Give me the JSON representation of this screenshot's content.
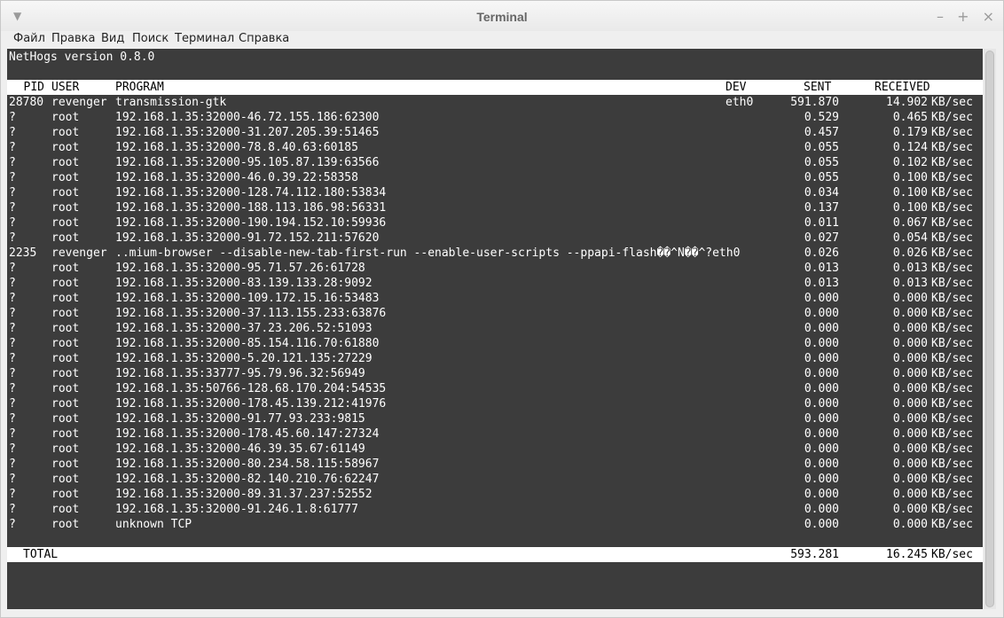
{
  "window": {
    "title": "Terminal",
    "menu_icon": "chevron-down-icon",
    "buttons": {
      "minimize": "–",
      "maximize": "+",
      "close": "×"
    }
  },
  "menu": [
    "Файл",
    "Правка",
    "Вид",
    "Поиск",
    "Терминал",
    "Справка"
  ],
  "terminal": {
    "version_line": "NetHogs version 0.8.0",
    "headers": {
      "pid": "PID",
      "user": "USER",
      "program": "PROGRAM",
      "dev": "DEV",
      "sent": "SENT",
      "received": "RECEIVED"
    },
    "rows": [
      {
        "pid": "28780",
        "user": "revenger",
        "program": "transmission-gtk",
        "dev": "eth0",
        "sent": "591.870",
        "received": "14.902",
        "unit": "KB/sec"
      },
      {
        "pid": "?",
        "user": "root",
        "program": "192.168.1.35:32000-46.72.155.186:62300",
        "dev": "",
        "sent": "0.529",
        "received": "0.465",
        "unit": "KB/sec"
      },
      {
        "pid": "?",
        "user": "root",
        "program": "192.168.1.35:32000-31.207.205.39:51465",
        "dev": "",
        "sent": "0.457",
        "received": "0.179",
        "unit": "KB/sec"
      },
      {
        "pid": "?",
        "user": "root",
        "program": "192.168.1.35:32000-78.8.40.63:60185",
        "dev": "",
        "sent": "0.055",
        "received": "0.124",
        "unit": "KB/sec"
      },
      {
        "pid": "?",
        "user": "root",
        "program": "192.168.1.35:32000-95.105.87.139:63566",
        "dev": "",
        "sent": "0.055",
        "received": "0.102",
        "unit": "KB/sec"
      },
      {
        "pid": "?",
        "user": "root",
        "program": "192.168.1.35:32000-46.0.39.22:58358",
        "dev": "",
        "sent": "0.055",
        "received": "0.100",
        "unit": "KB/sec"
      },
      {
        "pid": "?",
        "user": "root",
        "program": "192.168.1.35:32000-128.74.112.180:53834",
        "dev": "",
        "sent": "0.034",
        "received": "0.100",
        "unit": "KB/sec"
      },
      {
        "pid": "?",
        "user": "root",
        "program": "192.168.1.35:32000-188.113.186.98:56331",
        "dev": "",
        "sent": "0.137",
        "received": "0.100",
        "unit": "KB/sec"
      },
      {
        "pid": "?",
        "user": "root",
        "program": "192.168.1.35:32000-190.194.152.10:59936",
        "dev": "",
        "sent": "0.011",
        "received": "0.067",
        "unit": "KB/sec"
      },
      {
        "pid": "?",
        "user": "root",
        "program": "192.168.1.35:32000-91.72.152.211:57620",
        "dev": "",
        "sent": "0.027",
        "received": "0.054",
        "unit": "KB/sec"
      },
      {
        "pid": "2235",
        "user": "revenger",
        "program": "..mium-browser --disable-new-tab-first-run --enable-user-scripts --ppapi-flash��^N��^?eth0",
        "dev": "",
        "sent": "0.026",
        "received": "0.026",
        "unit": "KB/sec"
      },
      {
        "pid": "?",
        "user": "root",
        "program": "192.168.1.35:32000-95.71.57.26:61728",
        "dev": "",
        "sent": "0.013",
        "received": "0.013",
        "unit": "KB/sec"
      },
      {
        "pid": "?",
        "user": "root",
        "program": "192.168.1.35:32000-83.139.133.28:9092",
        "dev": "",
        "sent": "0.013",
        "received": "0.013",
        "unit": "KB/sec"
      },
      {
        "pid": "?",
        "user": "root",
        "program": "192.168.1.35:32000-109.172.15.16:53483",
        "dev": "",
        "sent": "0.000",
        "received": "0.000",
        "unit": "KB/sec"
      },
      {
        "pid": "?",
        "user": "root",
        "program": "192.168.1.35:32000-37.113.155.233:63876",
        "dev": "",
        "sent": "0.000",
        "received": "0.000",
        "unit": "KB/sec"
      },
      {
        "pid": "?",
        "user": "root",
        "program": "192.168.1.35:32000-37.23.206.52:51093",
        "dev": "",
        "sent": "0.000",
        "received": "0.000",
        "unit": "KB/sec"
      },
      {
        "pid": "?",
        "user": "root",
        "program": "192.168.1.35:32000-85.154.116.70:61880",
        "dev": "",
        "sent": "0.000",
        "received": "0.000",
        "unit": "KB/sec"
      },
      {
        "pid": "?",
        "user": "root",
        "program": "192.168.1.35:32000-5.20.121.135:27229",
        "dev": "",
        "sent": "0.000",
        "received": "0.000",
        "unit": "KB/sec"
      },
      {
        "pid": "?",
        "user": "root",
        "program": "192.168.1.35:33777-95.79.96.32:56949",
        "dev": "",
        "sent": "0.000",
        "received": "0.000",
        "unit": "KB/sec"
      },
      {
        "pid": "?",
        "user": "root",
        "program": "192.168.1.35:50766-128.68.170.204:54535",
        "dev": "",
        "sent": "0.000",
        "received": "0.000",
        "unit": "KB/sec"
      },
      {
        "pid": "?",
        "user": "root",
        "program": "192.168.1.35:32000-178.45.139.212:41976",
        "dev": "",
        "sent": "0.000",
        "received": "0.000",
        "unit": "KB/sec"
      },
      {
        "pid": "?",
        "user": "root",
        "program": "192.168.1.35:32000-91.77.93.233:9815",
        "dev": "",
        "sent": "0.000",
        "received": "0.000",
        "unit": "KB/sec"
      },
      {
        "pid": "?",
        "user": "root",
        "program": "192.168.1.35:32000-178.45.60.147:27324",
        "dev": "",
        "sent": "0.000",
        "received": "0.000",
        "unit": "KB/sec"
      },
      {
        "pid": "?",
        "user": "root",
        "program": "192.168.1.35:32000-46.39.35.67:61149",
        "dev": "",
        "sent": "0.000",
        "received": "0.000",
        "unit": "KB/sec"
      },
      {
        "pid": "?",
        "user": "root",
        "program": "192.168.1.35:32000-80.234.58.115:58967",
        "dev": "",
        "sent": "0.000",
        "received": "0.000",
        "unit": "KB/sec"
      },
      {
        "pid": "?",
        "user": "root",
        "program": "192.168.1.35:32000-82.140.210.76:62247",
        "dev": "",
        "sent": "0.000",
        "received": "0.000",
        "unit": "KB/sec"
      },
      {
        "pid": "?",
        "user": "root",
        "program": "192.168.1.35:32000-89.31.37.237:52552",
        "dev": "",
        "sent": "0.000",
        "received": "0.000",
        "unit": "KB/sec"
      },
      {
        "pid": "?",
        "user": "root",
        "program": "192.168.1.35:32000-91.246.1.8:61777",
        "dev": "",
        "sent": "0.000",
        "received": "0.000",
        "unit": "KB/sec"
      },
      {
        "pid": "?",
        "user": "root",
        "program": "unknown TCP",
        "dev": "",
        "sent": "0.000",
        "received": "0.000",
        "unit": "KB/sec"
      }
    ],
    "total": {
      "label": "TOTAL",
      "sent": "593.281",
      "received": "16.245",
      "unit": "KB/sec"
    }
  },
  "colors": {
    "terminal_bg": "#3c3c3c",
    "terminal_fg": "#ffffff",
    "highlight_bg": "#ffffff"
  }
}
